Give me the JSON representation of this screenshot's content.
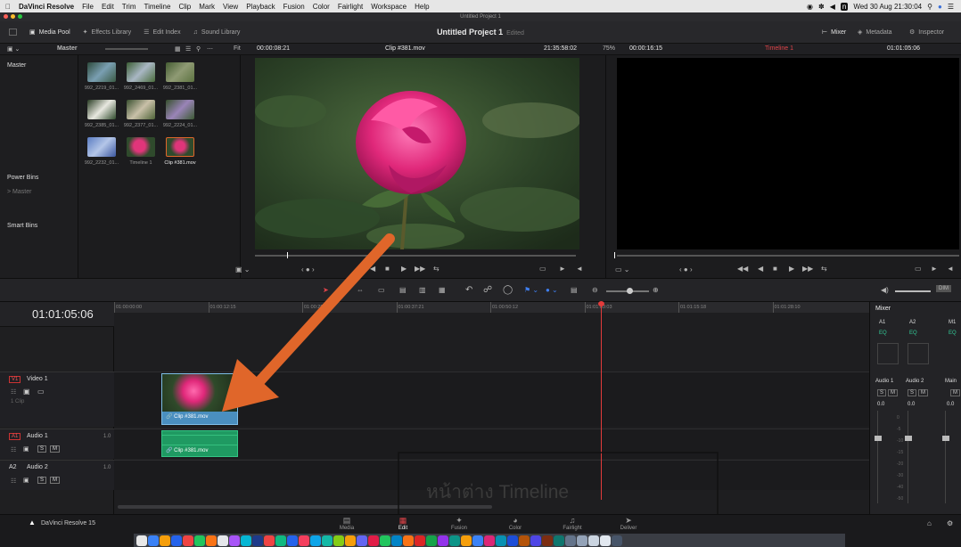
{
  "menubar": {
    "apple": "",
    "app": "DaVinci Resolve",
    "items": [
      "File",
      "Edit",
      "Trim",
      "Timeline",
      "Clip",
      "Mark",
      "View",
      "Playback",
      "Fusion",
      "Color",
      "Fairlight",
      "Workspace",
      "Help"
    ],
    "datetime": "Wed 30 Aug 21:30:04"
  },
  "window": {
    "title": "Untitled Project 1"
  },
  "toolbar": {
    "media_pool": "Media Pool",
    "effects": "Effects Library",
    "edit_index": "Edit Index",
    "sound_library": "Sound Library",
    "project": "Untitled Project 1",
    "status": "Edited",
    "mixer": "Mixer",
    "metadata": "Metadata",
    "inspector": "Inspector"
  },
  "viewer_header": {
    "bin": "Master",
    "fit": "Fit",
    "src_duration": "00:00:08:21",
    "clip": "Clip #381.mov",
    "src_timecode": "21:35:58:02",
    "zoom": "75%",
    "tl_duration": "00:00:16:15",
    "timeline": "Timeline 1",
    "tl_timecode": "01:01:05:06"
  },
  "bins": {
    "master": "Master",
    "power_bins": "Power Bins",
    "power_master": "Master",
    "smart_bins": "Smart Bins"
  },
  "thumbs": [
    "992_2219_01...",
    "992_2469_01...",
    "992_2381_01...",
    "992_2385_01...",
    "992_2377_01...",
    "992_2224_01...",
    "992_2232_01...",
    "Timeline 1",
    "Clip #381.mov"
  ],
  "timeline": {
    "timecode": "01:01:05:06",
    "ruler": [
      "01:00:00:00",
      "01:00:12:15",
      "01:00:25:00",
      "01:00:37:21",
      "01:00:50:12",
      "01:01:03:03",
      "01:01:15:18",
      "01:01:28:10"
    ],
    "tracks": {
      "v1_tag": "V1",
      "v1_name": "Video 1",
      "v1_clips": "1 Clip",
      "a1_tag": "A1",
      "a1_name": "Audio 1",
      "a1_ch": "1.0",
      "a2_tag": "A2",
      "a2_name": "Audio 2",
      "a2_ch": "1.0"
    },
    "clip_video": "Clip #381.mov",
    "clip_audio": "Clip #381.mov",
    "overlay": "หน้าต่าง Timeline"
  },
  "mixer": {
    "title": "Mixer",
    "ch": [
      "A1",
      "A2",
      "M1"
    ],
    "eq": "EQ",
    "strip": [
      "Audio 1",
      "Audio 2",
      "Main"
    ],
    "level": "0.0",
    "db": [
      "0",
      "-5",
      "-10",
      "-15",
      "-20",
      "-30",
      "-40",
      "-50"
    ]
  },
  "footer": {
    "brand": "DaVinci Resolve 15",
    "pages": [
      "Media",
      "Edit",
      "Fusion",
      "Color",
      "Fairlight",
      "Deliver"
    ],
    "active": "Edit"
  },
  "colors": {
    "accent": "#e0662a",
    "playhead": "#e23b3b",
    "video_clip": "#4a8fbf",
    "audio_clip": "#1f9a62"
  }
}
